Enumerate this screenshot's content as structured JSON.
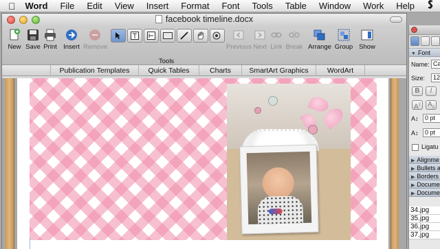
{
  "menubar": {
    "app": "Word",
    "items": [
      "File",
      "Edit",
      "View",
      "Insert",
      "Format",
      "Font",
      "Tools",
      "Table",
      "Window",
      "Work",
      "Help"
    ],
    "script_icon": "script-menu-icon"
  },
  "window": {
    "title": "facebook timeline.docx",
    "colors": {
      "close": "#e0443a",
      "minimize": "#e3a21c",
      "zoom": "#54b02c"
    }
  },
  "toolbar": {
    "new_label": "New",
    "save_label": "Save",
    "print_label": "Print",
    "insert_label": "Insert",
    "remove_label": "Remove",
    "tools_label": "Tools",
    "previous_label": "Previous",
    "next_label": "Next",
    "link_label": "Link",
    "break_label": "Break",
    "arrange_label": "Arrange",
    "group_label": "Group",
    "show_label": "Show",
    "tool_icons": [
      "select-arrow-icon",
      "text-box-icon",
      "vertical-text-box-icon",
      "rectangle-icon",
      "line-icon",
      "hand-pan-icon",
      "shape-picker-icon"
    ]
  },
  "ribbon": {
    "tabs": [
      "Publication Templates",
      "Quick Tables",
      "Charts",
      "SmartArt Graphics",
      "WordArt"
    ]
  },
  "document": {
    "background_color": "#f08caa",
    "photo_description_alt": "Baby photo in polaroid frame"
  },
  "palette": {
    "section_font": "Font",
    "name_label": "Name:",
    "name_value": "Ca",
    "size_label": "Size:",
    "size_value": "12",
    "bold": "B",
    "italic": "I",
    "spacing_before": "0 pt",
    "spacing_after": "0 pt",
    "ligatures_label": "Ligatu",
    "sections": [
      "Alignme",
      "Bullets a",
      "Borders",
      "Docume",
      "Docume"
    ],
    "files": [
      "34.jpg",
      "35.jpg",
      "36.jpg",
      "37.jpg"
    ]
  }
}
